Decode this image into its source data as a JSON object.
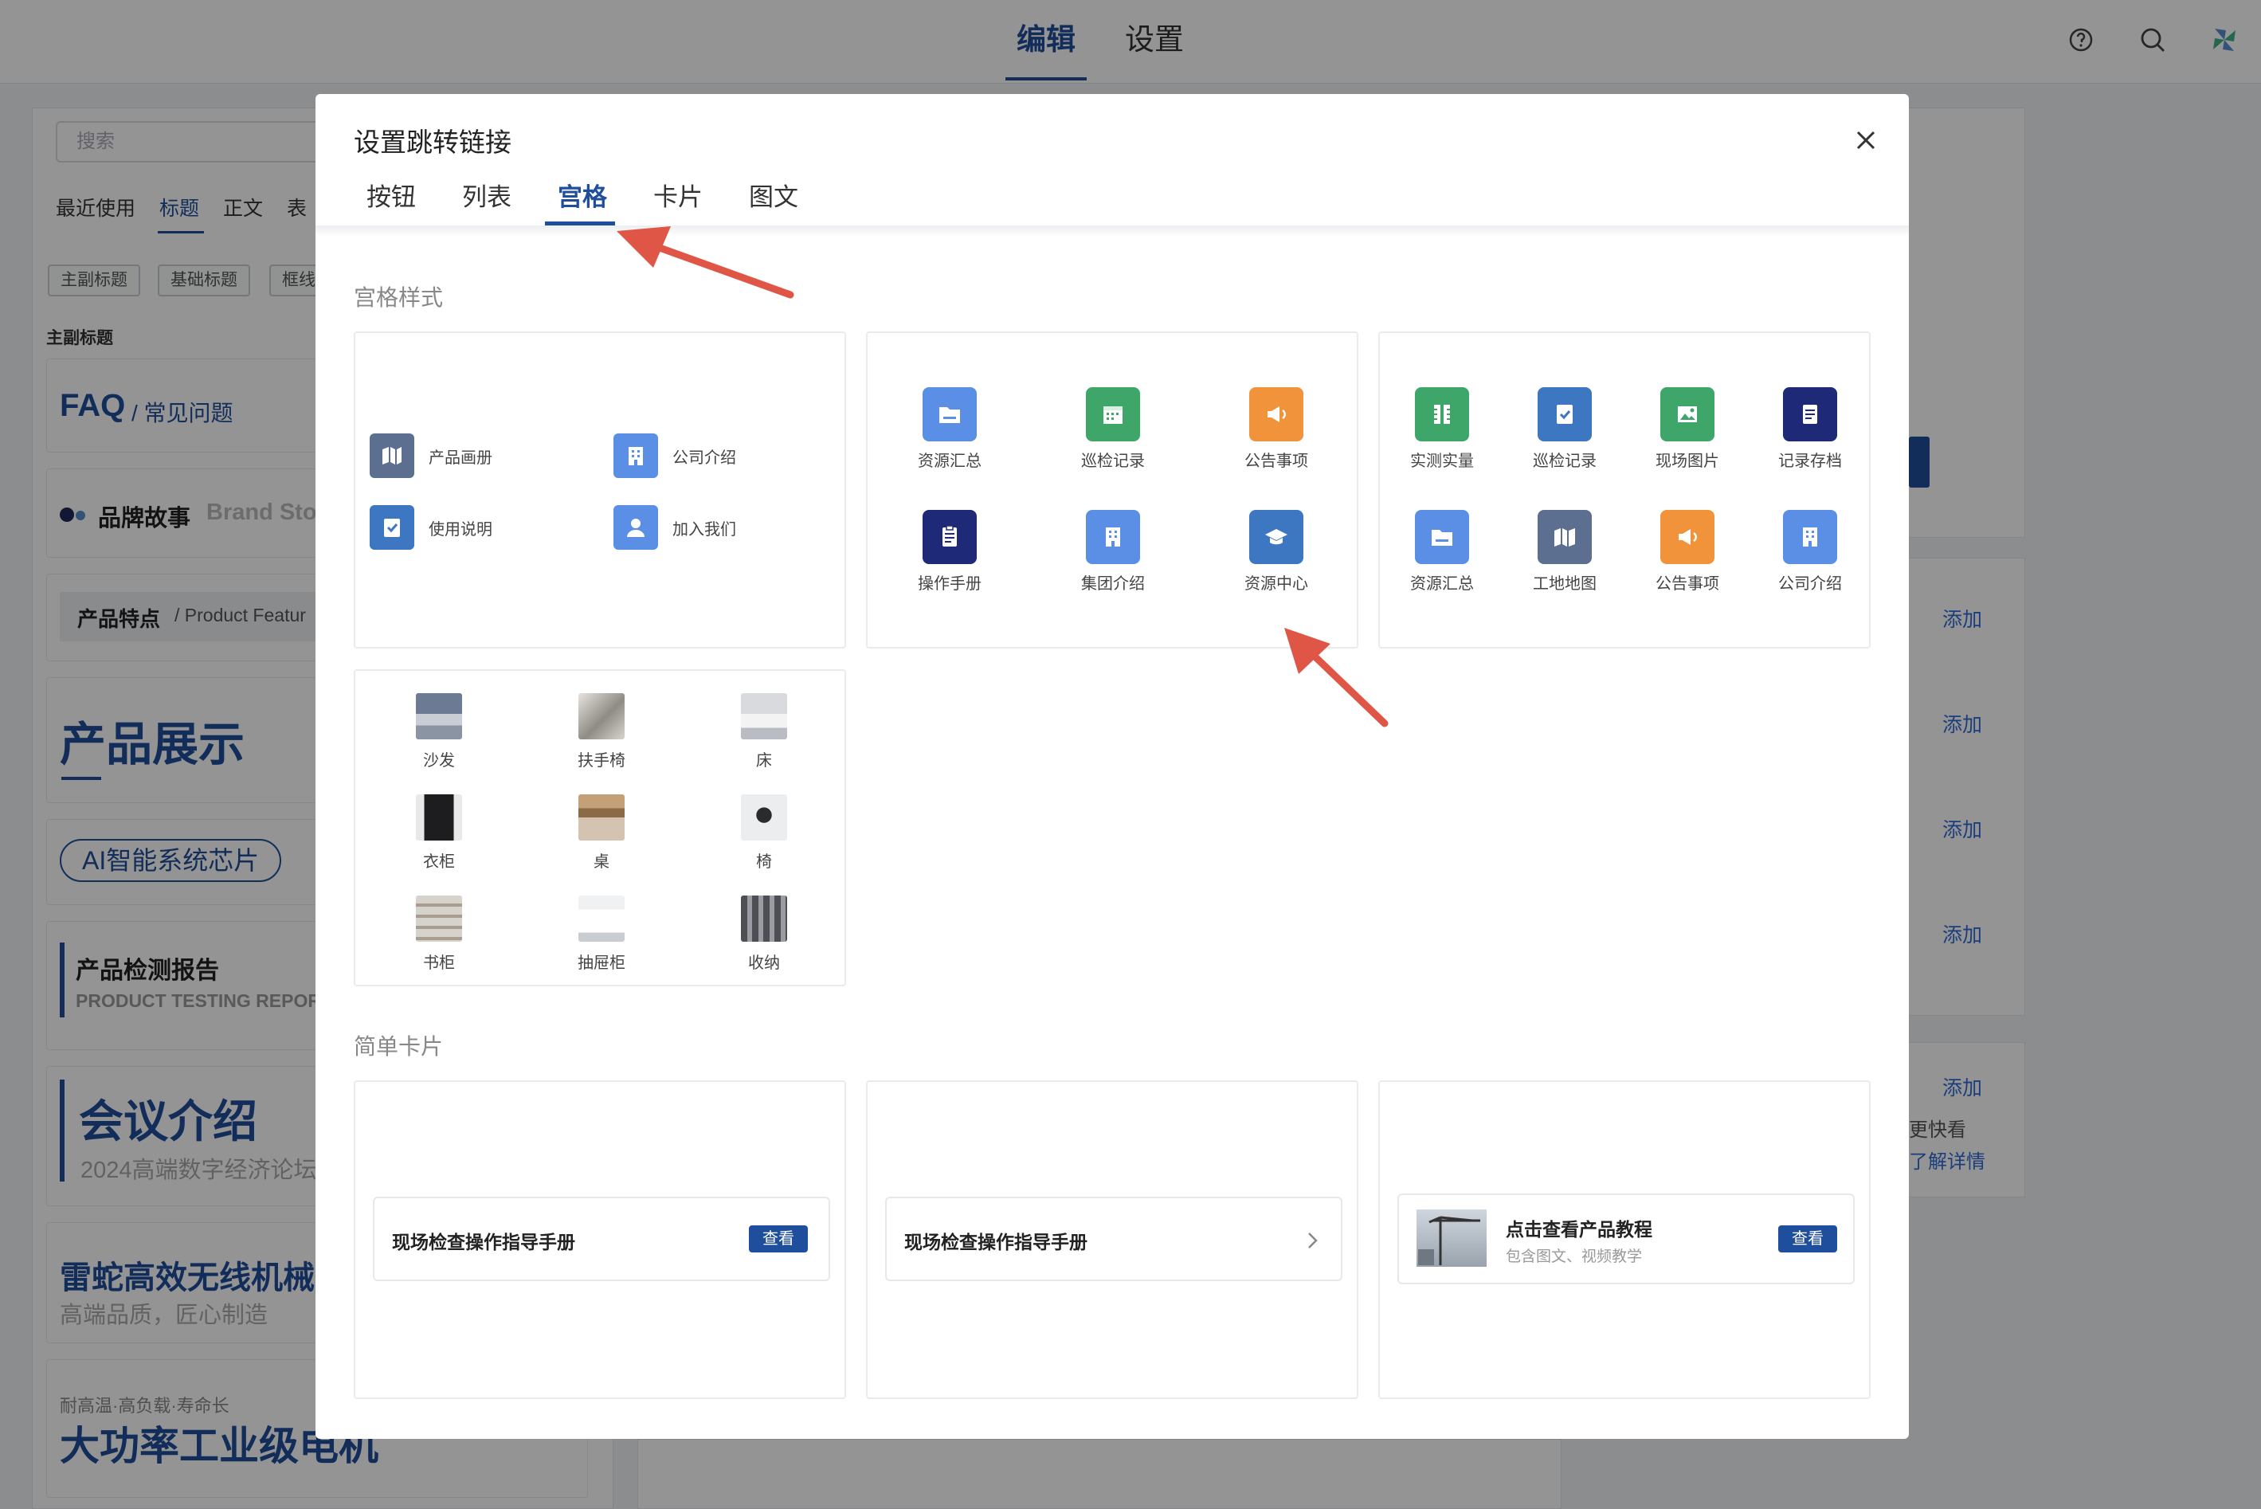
{
  "topbar": {
    "tabs": [
      {
        "label": "编辑",
        "active": true
      },
      {
        "label": "设置",
        "active": false
      }
    ],
    "icons": [
      "help-icon",
      "search-icon",
      "settings-icon"
    ]
  },
  "left_panel": {
    "search_placeholder": "搜索",
    "tabs": [
      "最近使用",
      "标题",
      "正文",
      "表"
    ],
    "chips": [
      "主副标题",
      "基础标题",
      "框线"
    ],
    "section": "主副标题",
    "items": [
      {
        "text": "FAQ",
        "sub": "/ 常见问题"
      },
      {
        "text": "品牌故事",
        "sub": "Brand Sto"
      },
      {
        "text": "产品特点",
        "sub": "/ Product Featur"
      },
      {
        "text": "产品展示"
      },
      {
        "text": "AI智能系统芯片"
      },
      {
        "text": "产品检测报告",
        "sub": "PRODUCT TESTING REPOR"
      },
      {
        "text": "会议介绍",
        "sub": "2024高端数字经济论坛"
      },
      {
        "text": "雷蛇高效无线机械",
        "sub": "高端品质，匠心制造"
      },
      {
        "small": "耐高温·高负载·寿命长",
        "text": "大功率工业级电机"
      }
    ]
  },
  "right_panel": {
    "links": [
      "添加",
      "添加",
      "添加",
      "添加",
      "添加"
    ],
    "texts": [
      "更快看",
      "了解详情"
    ]
  },
  "modal": {
    "title": "设置跳转链接",
    "tabs": [
      "按钮",
      "列表",
      "宫格",
      "卡片",
      "图文"
    ],
    "active_tab": "宫格",
    "grid_section": "宫格样式",
    "list_style": [
      {
        "label": "产品画册",
        "icon": "map-icon",
        "color": "#5c6f91"
      },
      {
        "label": "公司介绍",
        "icon": "building-icon",
        "color": "#5b8fe6"
      },
      {
        "label": "使用说明",
        "icon": "checklist-icon",
        "color": "#3d77c2"
      },
      {
        "label": "加入我们",
        "icon": "user-icon",
        "color": "#5b8fe6"
      }
    ],
    "grid3": [
      {
        "label": "资源汇总",
        "icon": "folder-icon",
        "color": "#5b8fe6"
      },
      {
        "label": "巡检记录",
        "icon": "calendar-icon",
        "color": "#3fa66a"
      },
      {
        "label": "公告事项",
        "icon": "megaphone-icon",
        "color": "#f0933a"
      },
      {
        "label": "操作手册",
        "icon": "document-icon",
        "color": "#1e2a78"
      },
      {
        "label": "集团介绍",
        "icon": "building-icon",
        "color": "#5b8fe6"
      },
      {
        "label": "资源中心",
        "icon": "graduation-cap-icon",
        "color": "#3d77c2"
      }
    ],
    "grid4": [
      {
        "label": "实测实量",
        "icon": "ruler-icon",
        "color": "#3fa66a"
      },
      {
        "label": "巡检记录",
        "icon": "checklist-icon",
        "color": "#3d77c2"
      },
      {
        "label": "现场图片",
        "icon": "image-icon",
        "color": "#3fa66a"
      },
      {
        "label": "记录存档",
        "icon": "document-icon",
        "color": "#1e2a78"
      },
      {
        "label": "资源汇总",
        "icon": "folder-icon",
        "color": "#5b8fe6"
      },
      {
        "label": "工地地图",
        "icon": "map-icon",
        "color": "#5c6f91"
      },
      {
        "label": "公告事项",
        "icon": "megaphone-icon",
        "color": "#f0933a"
      },
      {
        "label": "公司介绍",
        "icon": "building-icon",
        "color": "#5b8fe6"
      }
    ],
    "furniture": [
      "沙发",
      "扶手椅",
      "床",
      "衣柜",
      "桌",
      "椅",
      "书柜",
      "抽屉柜",
      "收纳"
    ],
    "card_section": "简单卡片",
    "cards": [
      {
        "title": "现场检查操作指导手册",
        "button": "查看"
      },
      {
        "title": "现场检查操作指导手册"
      },
      {
        "title": "点击查看产品教程",
        "subtitle": "包含图文、视频教学",
        "button": "查看"
      }
    ]
  },
  "colors": {
    "accent": "#1f4f9c",
    "annotation": "#e05646"
  }
}
